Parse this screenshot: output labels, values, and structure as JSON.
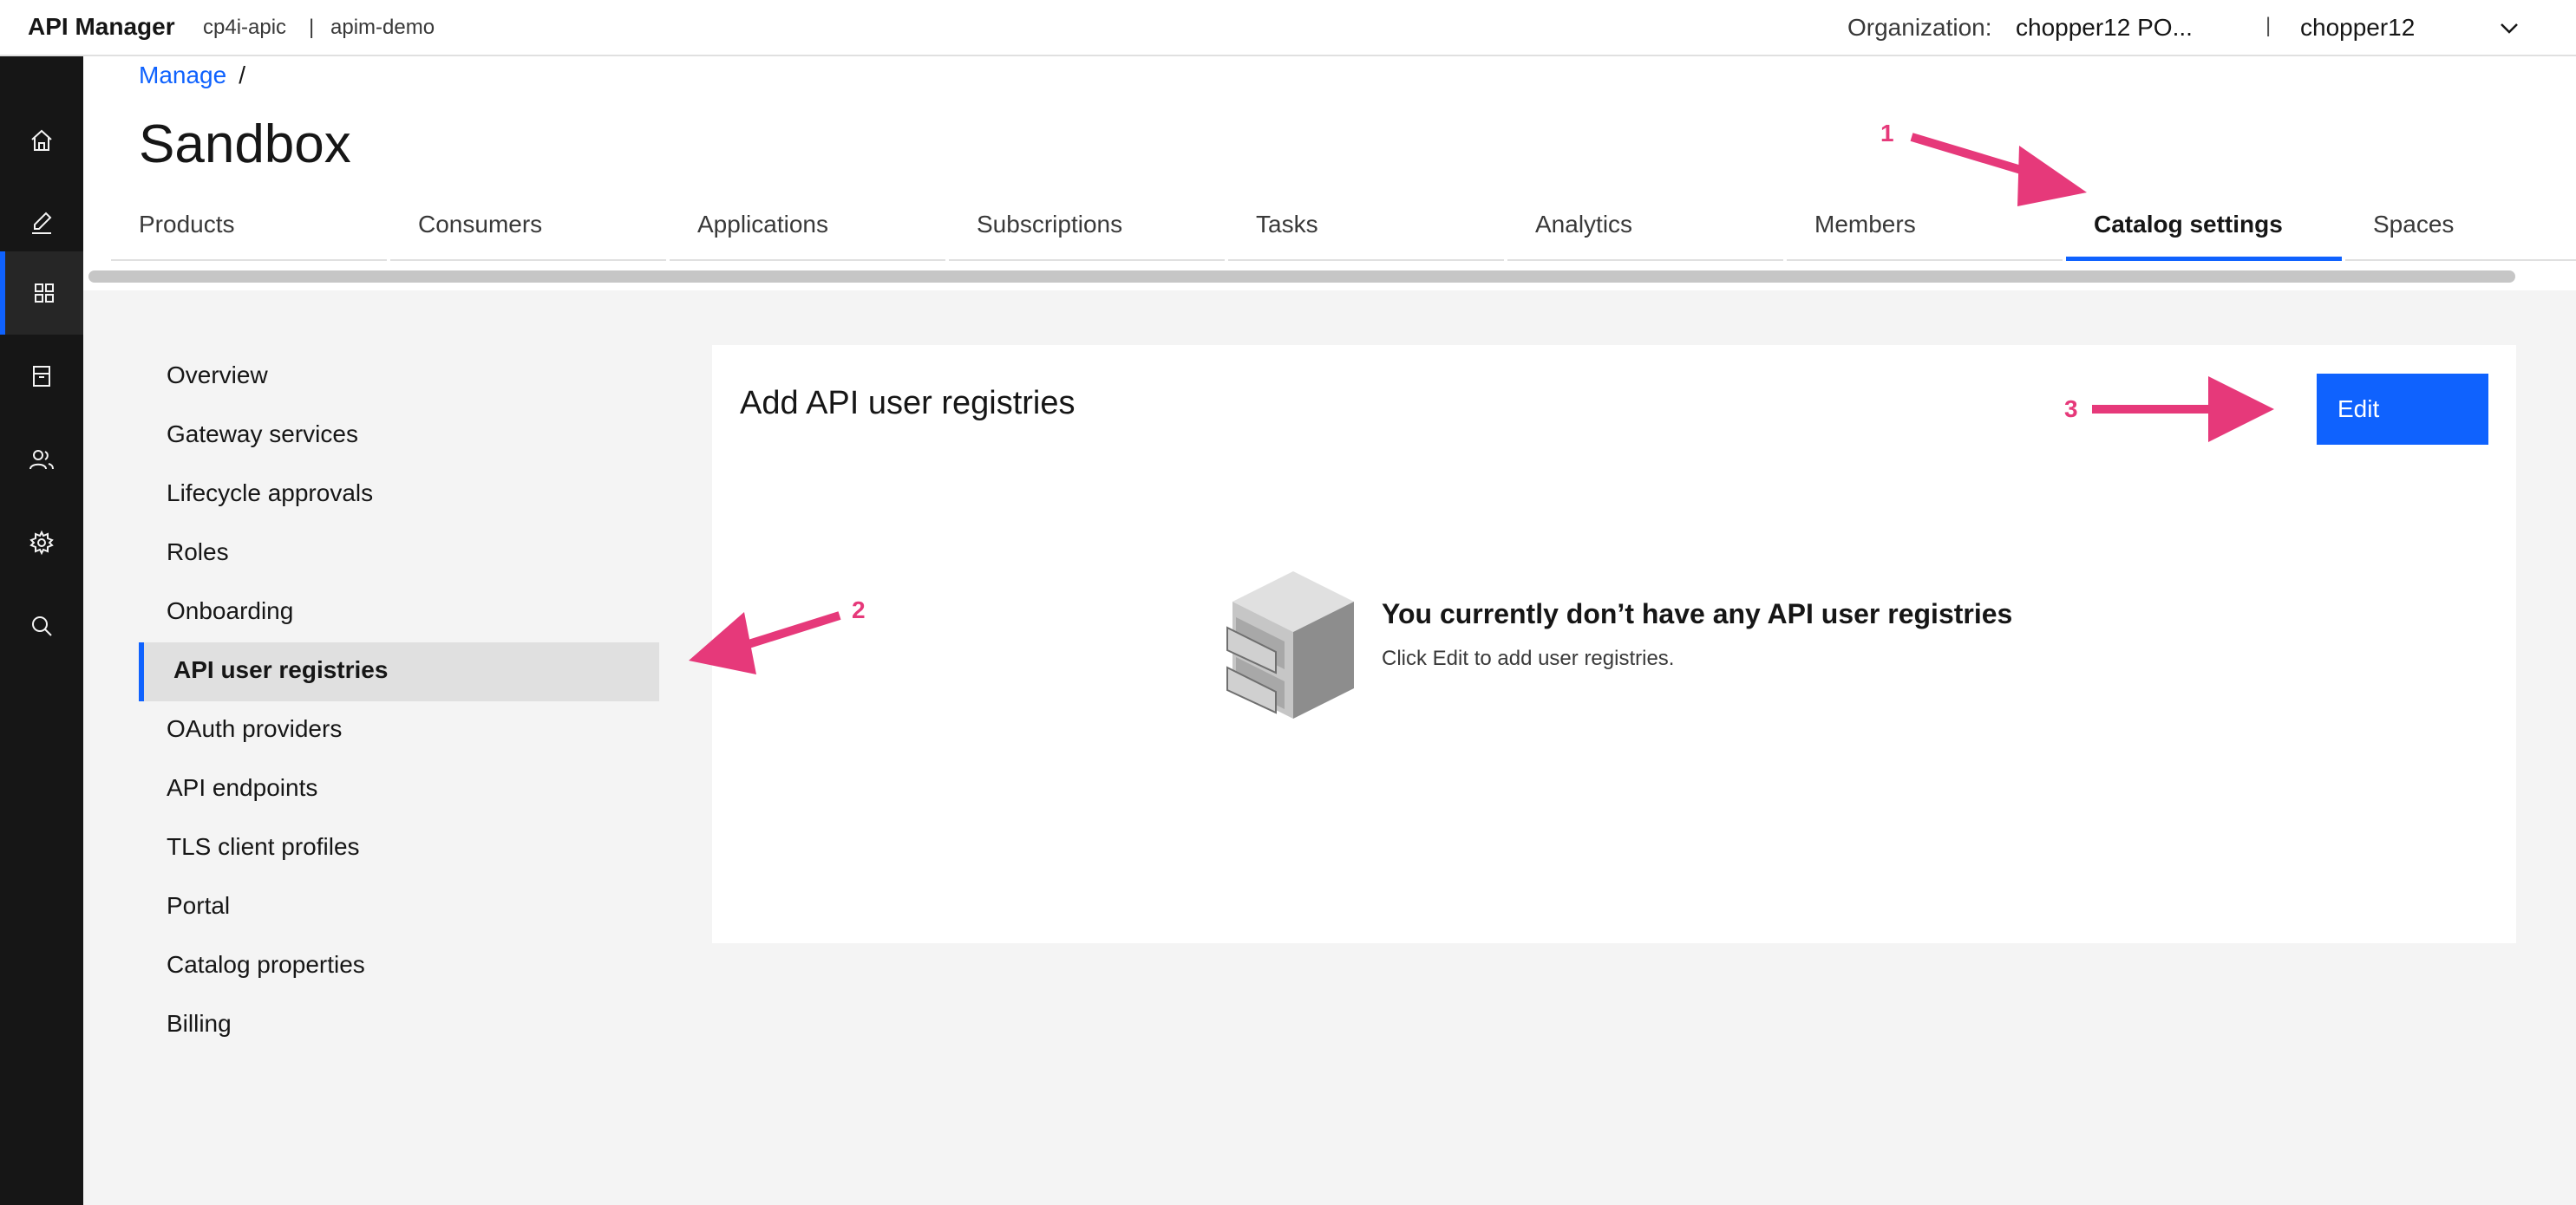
{
  "header": {
    "brand": "API Manager",
    "crumb_1": "cp4i-apic",
    "crumb_sep": "|",
    "crumb_2": "apim-demo",
    "org_label": "Organization:",
    "org_value": "chopper12 PO...",
    "user_sep": "|",
    "user": "chopper12"
  },
  "rail": {
    "icons": [
      "home-icon",
      "edit-icon",
      "grid-icon",
      "archive-icon",
      "users-icon",
      "settings-icon",
      "search-icon"
    ],
    "active": "grid-icon"
  },
  "page": {
    "breadcrumb_link": "Manage",
    "breadcrumb_sep": "/",
    "title": "Sandbox"
  },
  "tabs": [
    {
      "label": "Products"
    },
    {
      "label": "Consumers"
    },
    {
      "label": "Applications"
    },
    {
      "label": "Subscriptions"
    },
    {
      "label": "Tasks"
    },
    {
      "label": "Analytics"
    },
    {
      "label": "Members"
    },
    {
      "label": "Catalog settings"
    },
    {
      "label": "Spaces"
    }
  ],
  "active_tab": "Catalog settings",
  "sidenav": {
    "items": [
      {
        "label": "Overview"
      },
      {
        "label": "Gateway services"
      },
      {
        "label": "Lifecycle approvals"
      },
      {
        "label": "Roles"
      },
      {
        "label": "Onboarding"
      },
      {
        "label": "API user registries"
      },
      {
        "label": "OAuth providers"
      },
      {
        "label": "API endpoints"
      },
      {
        "label": "TLS client profiles"
      },
      {
        "label": "Portal"
      },
      {
        "label": "Catalog properties"
      },
      {
        "label": "Billing"
      }
    ],
    "active": "API user registries"
  },
  "panel": {
    "title": "Add API user registries",
    "edit_label": "Edit",
    "empty_title": "You currently don’t have any API user registries",
    "empty_subtitle": "Click Edit to add user registries."
  },
  "annotations": {
    "one": "1",
    "two": "2",
    "three": "3"
  },
  "colors": {
    "accent": "#0f62fe",
    "annotation": "#e6397a",
    "rail": "#161616",
    "content_bg": "#f4f4f4"
  }
}
